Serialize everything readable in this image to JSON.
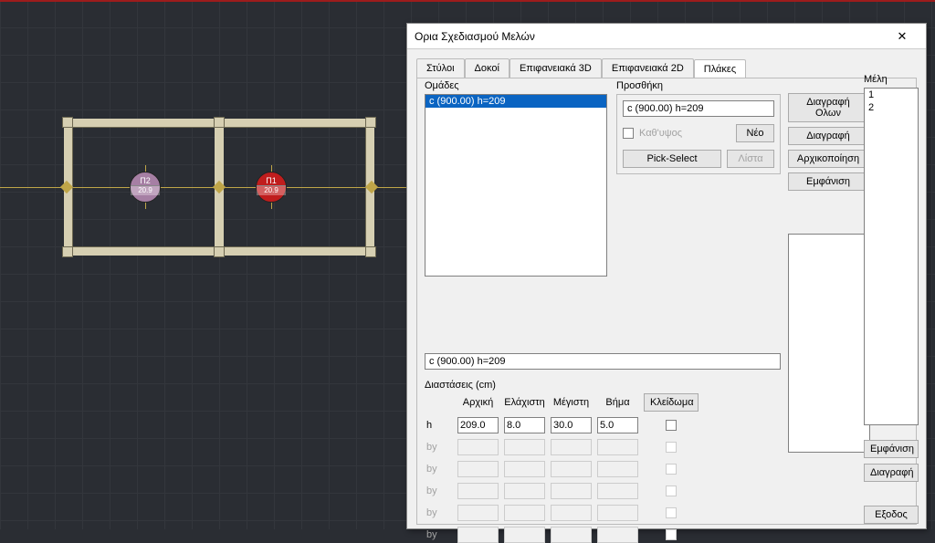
{
  "window": {
    "title": "Ορια Σχεδιασμού Μελών"
  },
  "tabs": {
    "t0": "Στύλοι",
    "t1": "Δοκοί",
    "t2": "Επιφανειακά 3D",
    "t3": "Επιφανειακά 2D",
    "t4": "Πλάκες"
  },
  "groups": {
    "label": "Ομάδες",
    "items": [
      "c (900.00) h=209"
    ],
    "selected": 0,
    "edit_value": "c (900.00) h=209"
  },
  "add": {
    "label": "Προσθήκη",
    "value": "c (900.00) h=209",
    "kath_upsos": "Καθ'υψος",
    "new_btn": "Νέο",
    "pick_btn": "Pick-Select",
    "list_btn": "Λίστα"
  },
  "actions": {
    "delete_all": "Διαγραφή Ολων",
    "delete": "Διαγραφή",
    "init": "Αρχικοποίηση",
    "show": "Εμφάνιση"
  },
  "members": {
    "label": "Μέλη",
    "items": [
      "1",
      "2"
    ],
    "show": "Εμφάνιση",
    "delete": "Διαγραφή",
    "exit": "Εξοδος"
  },
  "dims": {
    "label": "Διαστάσεις (cm)",
    "cols": {
      "c0": "Αρχική",
      "c1": "Ελάχιστη",
      "c2": "Μέγιστη",
      "c3": "Βήμα"
    },
    "lock": "Κλείδωμα",
    "rows": [
      {
        "name": "h",
        "v": [
          "209.0",
          "8.0",
          "30.0",
          "5.0"
        ],
        "enabled": true
      },
      {
        "name": "by",
        "v": [
          "",
          "",
          "",
          ""
        ],
        "enabled": false
      },
      {
        "name": "by",
        "v": [
          "",
          "",
          "",
          ""
        ],
        "enabled": false
      },
      {
        "name": "by",
        "v": [
          "",
          "",
          "",
          ""
        ],
        "enabled": false
      },
      {
        "name": "by",
        "v": [
          "",
          "",
          "",
          ""
        ],
        "enabled": false
      },
      {
        "name": "by",
        "v": [
          "",
          "",
          "",
          ""
        ],
        "enabled": false
      }
    ]
  },
  "cad": {
    "slab1": {
      "name": "Π1",
      "val": "20.9"
    },
    "slab2": {
      "name": "Π2",
      "val": "20.9"
    }
  }
}
